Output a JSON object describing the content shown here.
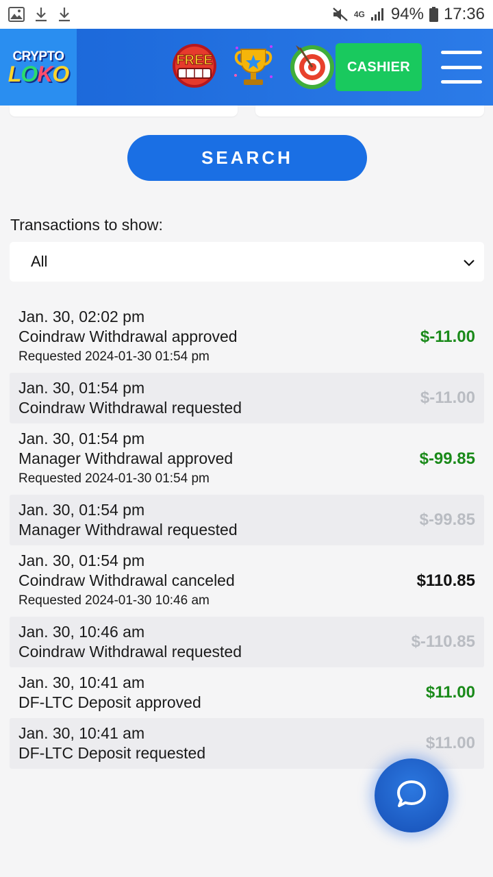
{
  "status_bar": {
    "network": "4G",
    "battery": "94%",
    "time": "17:36"
  },
  "header": {
    "logo_top": "CRYPTO",
    "logo_bottom": [
      "L",
      "O",
      "K",
      "O"
    ],
    "free_spins_label": "FREE",
    "cashier_label": "CASHIER"
  },
  "search": {
    "button_label": "SEARCH"
  },
  "filter": {
    "label": "Transactions to show:",
    "selected": "All"
  },
  "transactions": [
    {
      "date": "Jan. 30, 02:02 pm",
      "description": "Coindraw Withdrawal approved",
      "requested": "Requested 2024-01-30 01:54 pm",
      "amount": "$-11.00",
      "status": "approved"
    },
    {
      "date": "Jan. 30, 01:54 pm",
      "description": "Coindraw Withdrawal requested",
      "requested": "",
      "amount": "$-11.00",
      "status": "requested"
    },
    {
      "date": "Jan. 30, 01:54 pm",
      "description": "Manager Withdrawal approved",
      "requested": "Requested 2024-01-30 01:54 pm",
      "amount": "$-99.85",
      "status": "approved"
    },
    {
      "date": "Jan. 30, 01:54 pm",
      "description": "Manager Withdrawal requested",
      "requested": "",
      "amount": "$-99.85",
      "status": "requested"
    },
    {
      "date": "Jan. 30, 01:54 pm",
      "description": "Coindraw Withdrawal canceled",
      "requested": "Requested 2024-01-30 10:46 am",
      "amount": "$110.85",
      "status": "canceled"
    },
    {
      "date": "Jan. 30, 10:46 am",
      "description": "Coindraw Withdrawal requested",
      "requested": "",
      "amount": "$-110.85",
      "status": "requested"
    },
    {
      "date": "Jan. 30, 10:41 am",
      "description": "DF-LTC Deposit approved",
      "requested": "",
      "amount": "$11.00",
      "status": "approved"
    },
    {
      "date": "Jan. 30, 10:41 am",
      "description": "DF-LTC Deposit requested",
      "requested": "",
      "amount": "$11.00",
      "status": "requested"
    }
  ],
  "colors": {
    "approved": "#1a8a1a",
    "requested": "#b9bcc2",
    "canceled": "#111111",
    "header_blue": "#1a66d8",
    "cashier_green": "#19c95e"
  },
  "icons": [
    "gallery-icon",
    "download-icon",
    "download-icon",
    "mute-icon",
    "signal-icon",
    "battery-icon",
    "free-spins-icon",
    "trophy-icon",
    "target-icon",
    "menu-icon",
    "chevron-down-icon",
    "chat-icon"
  ]
}
